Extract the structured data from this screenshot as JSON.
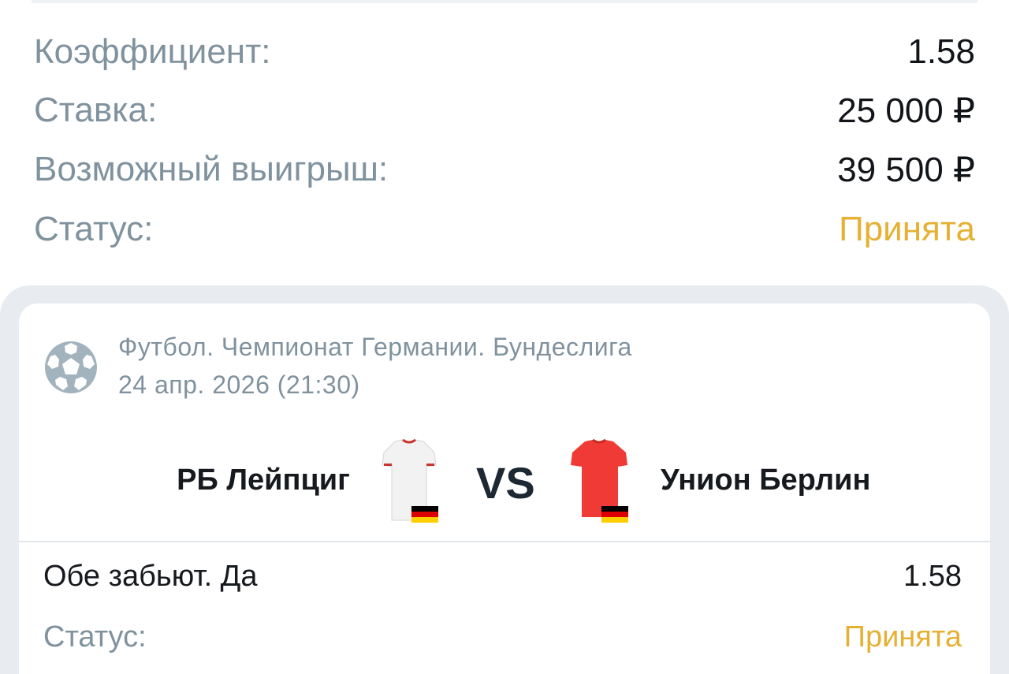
{
  "summary": {
    "coefficient": {
      "label": "Коэффициент:",
      "value": "1.58"
    },
    "stake": {
      "label": "Ставка:",
      "value": "25 000 ₽"
    },
    "possible_win": {
      "label": "Возможный выигрыш:",
      "value": "39 500 ₽"
    },
    "status": {
      "label": "Статус:",
      "value": "Принята"
    }
  },
  "event": {
    "league_icon": "soccer-ball-icon",
    "league": "Футбол. Чемпионат Германии. Бундеслига",
    "date": "24 апр. 2026 (21:30)",
    "home_team": "РБ Лейпциг",
    "away_team": "Унион Берлин",
    "vs": "VS",
    "home_jersey_color": "#f2f2f2",
    "away_jersey_color": "#f03a35",
    "flag_icon": "germany-flag-icon"
  },
  "bet": {
    "market": "Обе забьют. Да",
    "odds": "1.58",
    "status_label": "Статус:",
    "status_value": "Принята"
  },
  "colors": {
    "accepted": "#e6b032",
    "muted_text": "#7f929e",
    "panel_bg": "#e8ecf1"
  }
}
